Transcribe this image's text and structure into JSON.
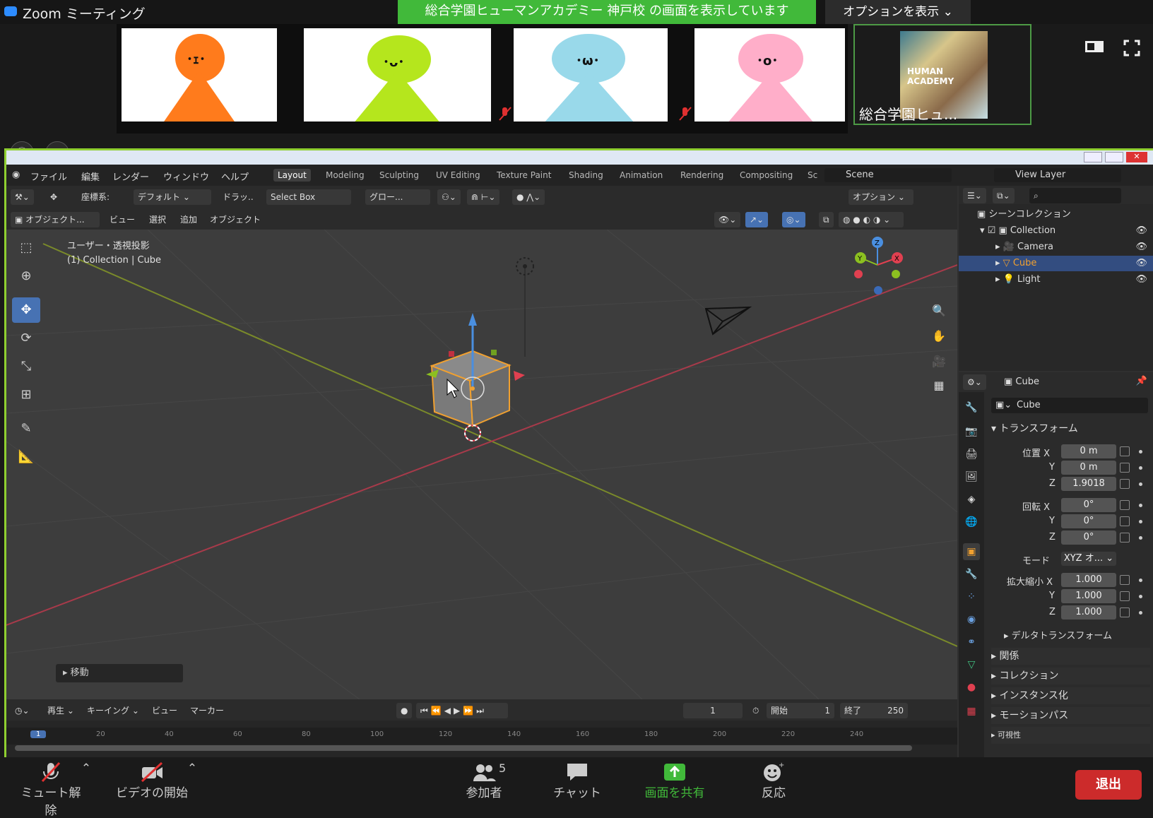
{
  "zoom": {
    "window_title": "Zoom ミーティング",
    "share_banner": "総合学園ヒューマンアカデミー 神戸校 の画面を表示しています",
    "options_label": "オプションを表示",
    "participants": [
      {
        "face": "･ｪ･",
        "color": "#ff7b1c"
      },
      {
        "face": "･ᴗ･",
        "color": "#b5e61d"
      },
      {
        "face": "･ω･",
        "color": "#99d9ea"
      },
      {
        "face": "･o･",
        "color": "#ffaec9"
      }
    ],
    "host_name": "総合学園ヒュ...",
    "host_logo": "HUMAN ACADEMY",
    "bottom": {
      "mute": "ミュート解除",
      "video": "ビデオの開始",
      "participants": "参加者",
      "participants_count": "5",
      "chat": "チャット",
      "share": "画面を共有",
      "reactions": "反応",
      "leave": "退出"
    },
    "colors": {
      "accent": "#41b93a",
      "leave": "#cc2b2b"
    }
  },
  "blender": {
    "menu": [
      "ファイル",
      "編集",
      "レンダー",
      "ウィンドウ",
      "ヘルプ"
    ],
    "workspaces": [
      "Layout",
      "Modeling",
      "Sculpting",
      "UV Editing",
      "Texture Paint",
      "Shading",
      "Animation",
      "Rendering",
      "Compositing",
      "Sc"
    ],
    "scene": "Scene",
    "view_layer": "View Layer",
    "header": {
      "coord": "座標系:",
      "default": "デフォルト",
      "drag": "ドラッ..",
      "select_box": "Select Box",
      "global": "グロー...",
      "options": "オプション"
    },
    "header2": {
      "mode": "オブジェクト...",
      "view": "ビュー",
      "select": "選択",
      "add": "追加",
      "object": "オブジェクト"
    },
    "viewport": {
      "info1": "ユーザー・透視投影",
      "info2": "(1) Collection | Cube",
      "last_op": "移動"
    },
    "timeline": {
      "playback": "再生",
      "keying": "キーイング",
      "view": "ビュー",
      "marker": "マーカー",
      "current": "1",
      "start_label": "開始",
      "start": "1",
      "end_label": "終了",
      "end": "250",
      "ticks": [
        "1",
        "20",
        "40",
        "60",
        "80",
        "100",
        "120",
        "140",
        "160",
        "180",
        "200",
        "220",
        "240"
      ]
    },
    "outliner": {
      "scene_collection": "シーンコレクション",
      "items": [
        "Collection",
        "Camera",
        "Cube",
        "Light"
      ]
    },
    "properties": {
      "object_name": "Cube",
      "name_field": "Cube",
      "transform": "トランスフォーム",
      "location_label": "位置 X",
      "y": "Y",
      "z": "Z",
      "loc_x": "0 m",
      "loc_y": "0 m",
      "loc_z": "1.9018",
      "rotation_label": "回転 X",
      "rot_x": "0°",
      "rot_y": "0°",
      "rot_z": "0°",
      "mode_label": "モード",
      "mode": "XYZ オ...",
      "scale_label": "拡大縮小 X",
      "scale_x": "1.000",
      "scale_y": "1.000",
      "scale_z": "1.000",
      "sections": [
        "デルタトランスフォーム",
        "関係",
        "コレクション",
        "インスタンス化",
        "モーションパス",
        "可視性"
      ]
    }
  }
}
